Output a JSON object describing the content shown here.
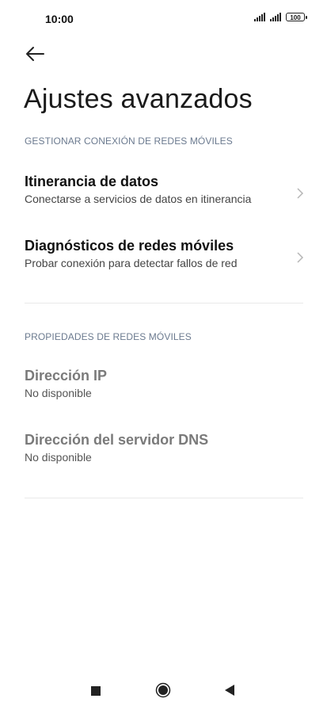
{
  "status_bar": {
    "time": "10:00",
    "battery": "100"
  },
  "page": {
    "title": "Ajustes avanzados"
  },
  "sections": [
    {
      "header": "GESTIONAR CONEXIÓN DE REDES MÓVILES",
      "items": [
        {
          "title": "Itinerancia de datos",
          "subtitle": "Conectarse a servicios de datos en itinerancia"
        },
        {
          "title": "Diagnósticos de redes móviles",
          "subtitle": "Probar conexión para detectar fallos de red"
        }
      ]
    },
    {
      "header": "PROPIEDADES DE REDES MÓVILES",
      "items": [
        {
          "title": "Dirección IP",
          "subtitle": "No disponible"
        },
        {
          "title": "Dirección del servidor DNS",
          "subtitle": "No disponible"
        }
      ]
    }
  ],
  "icons": {
    "back": "back-arrow-icon",
    "chevron": "chevron-right-icon",
    "nav_recents": "square-icon",
    "nav_home": "circle-icon",
    "nav_back": "triangle-back-icon"
  }
}
